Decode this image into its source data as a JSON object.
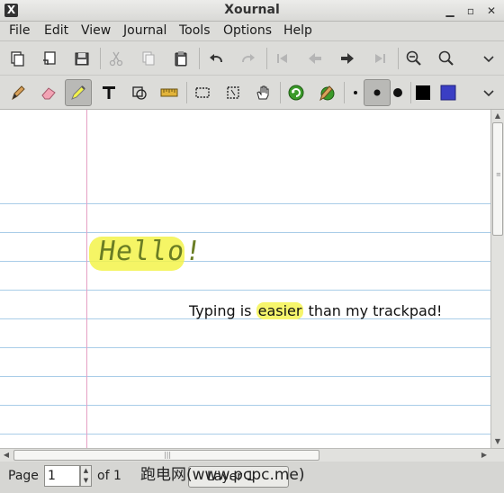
{
  "window": {
    "title": "Xournal",
    "app_icon": "x-logo-icon"
  },
  "menu": [
    "File",
    "Edit",
    "View",
    "Journal",
    "Tools",
    "Options",
    "Help"
  ],
  "toolbar1": [
    "new-icon",
    "annotate-pdf-icon",
    "save-icon",
    "cut-icon",
    "copy-icon",
    "paste-icon",
    "undo-icon",
    "redo-icon",
    "first-page-icon",
    "previous-page-icon",
    "next-page-icon",
    "last-page-icon",
    "zoom-out-icon",
    "zoom-in-icon",
    "chevron-down-icon"
  ],
  "toolbar2": [
    "pen-icon",
    "eraser-icon",
    "highlighter-icon",
    "text-icon",
    "shape-recognizer-icon",
    "ruler-icon",
    "select-rectangle-icon",
    "select-region-icon",
    "hand-icon",
    "default-tool-icon",
    "default-pen-icon",
    "thickness-fine-icon",
    "thickness-medium-icon",
    "thickness-thick-icon",
    "color-black-icon",
    "color-blue-icon",
    "chevron-down-icon"
  ],
  "colors": {
    "highlight": "#f3f34a",
    "margin_line": "#e6a0c4",
    "rule_line": "#a9cde8",
    "blue_swatch": "#3a3ec4"
  },
  "document": {
    "handwritten": "Hello!",
    "typed_before": "Typing is ",
    "typed_highlight": "easier",
    "typed_after": " than my trackpad!"
  },
  "status": {
    "page_label": "Page",
    "page_value": "1",
    "of_label": "of 1",
    "layer_label": "Layer 1"
  },
  "watermark": "跑电网(www.pcpc.me)"
}
